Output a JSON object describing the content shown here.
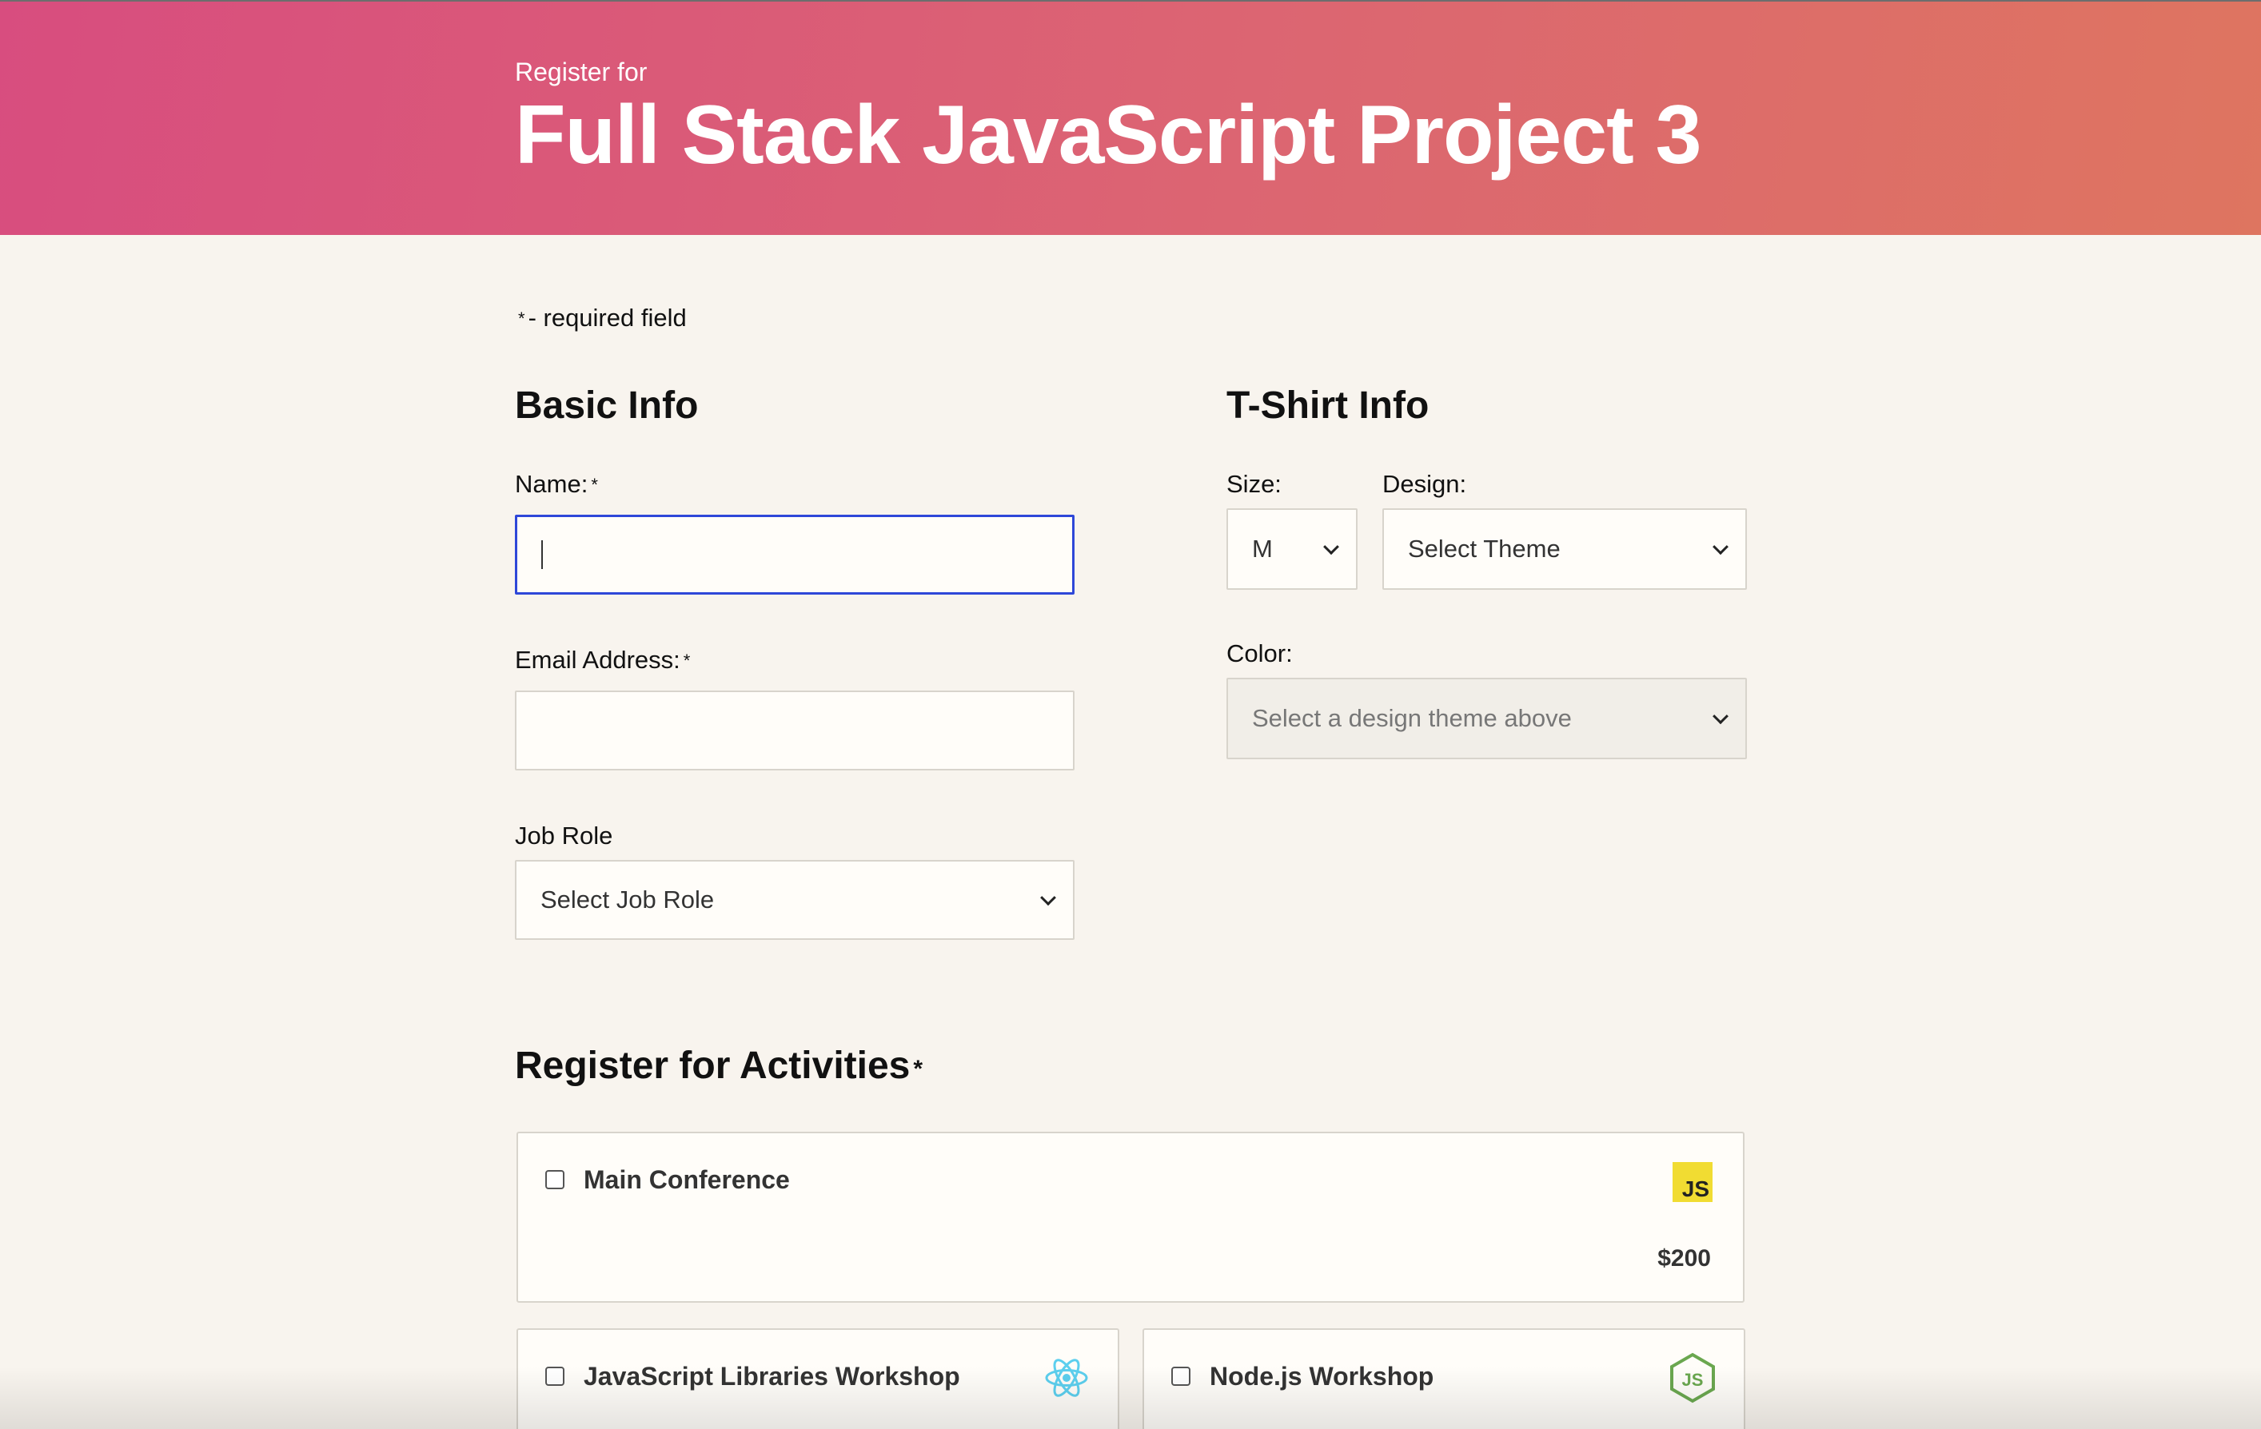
{
  "header": {
    "pre_title": "Register for",
    "title": "Full Stack JavaScript Project 3"
  },
  "required_note": "- required field",
  "required_marker": "*",
  "basic_info": {
    "heading": "Basic Info",
    "name_label": "Name:",
    "name_value": "",
    "email_label": "Email Address:",
    "email_value": "",
    "job_role_label": "Job Role",
    "job_role_selected": "Select Job Role"
  },
  "tshirt_info": {
    "heading": "T-Shirt Info",
    "size_label": "Size:",
    "size_selected": "M",
    "design_label": "Design:",
    "design_selected": "Select Theme",
    "color_label": "Color:",
    "color_selected": "Select a design theme above"
  },
  "activities": {
    "heading": "Register for Activities",
    "items": [
      {
        "label": "Main Conference",
        "price": "$200",
        "icon": "javascript-logo-icon",
        "icon_text": "JS",
        "checked": false
      },
      {
        "label": "JavaScript Libraries Workshop",
        "icon": "react-logo-icon",
        "checked": false
      },
      {
        "label": "Node.js Workshop",
        "icon": "nodejs-logo-icon",
        "checked": false
      }
    ]
  },
  "colors": {
    "header_gradient_start": "#d84d7f",
    "header_gradient_end": "#de7560",
    "page_background": "#f8f4ee",
    "focus_border": "#2e47d8",
    "js_badge": "#f1dc32",
    "react_blue": "#5ccfee",
    "node_green": "#6aa74f"
  }
}
